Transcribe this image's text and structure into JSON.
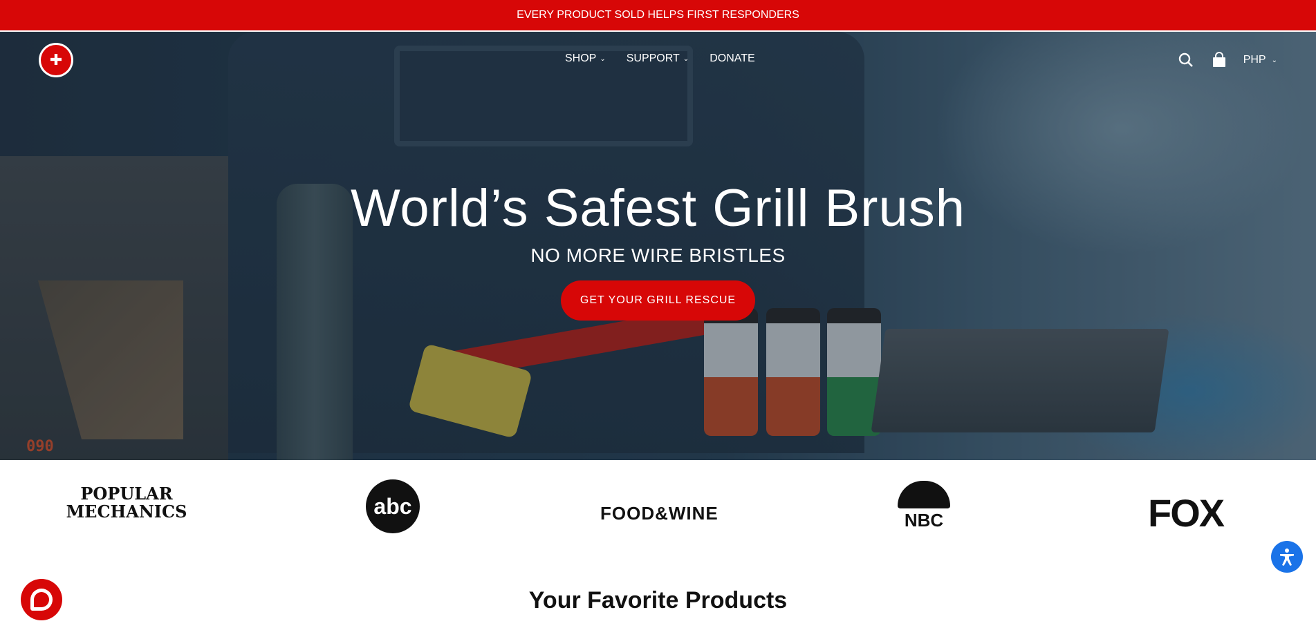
{
  "announcement": {
    "text": "EVERY PRODUCT SOLD HELPS FIRST RESPONDERS"
  },
  "header": {
    "logo_alt": "GRILL RESCUE",
    "nav": [
      {
        "label": "SHOP",
        "has_dropdown": true
      },
      {
        "label": "SUPPORT",
        "has_dropdown": true
      },
      {
        "label": "DONATE",
        "has_dropdown": false
      }
    ],
    "icons": [
      "search-icon",
      "cart-icon"
    ],
    "currency": "PHP"
  },
  "hero": {
    "title": "World’s Safest Grill Brush",
    "subtitle": "NO MORE WIRE BRISTLES",
    "cta_label": "GET YOUR GRILL RESCUE",
    "temp_readout": "090"
  },
  "press": {
    "logos": [
      {
        "name": "POPULAR MECHANICS",
        "line1": "POPULAR",
        "line2": "MECHANICS"
      },
      {
        "name": "abc",
        "text": "abc"
      },
      {
        "name": "FOOD & WINE",
        "text": "FOOD&WINE"
      },
      {
        "name": "NBC",
        "text": "NBC"
      },
      {
        "name": "FOX",
        "text": "FOX"
      }
    ]
  },
  "section": {
    "title": "Your Favorite Products"
  },
  "colors": {
    "brand_red": "#d70707",
    "accessibility_blue": "#1a73e8"
  }
}
